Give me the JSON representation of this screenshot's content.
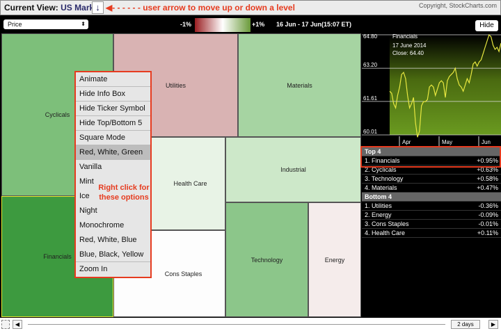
{
  "header": {
    "current_view_label": "Current View:",
    "current_view_value": "US Market",
    "level_arrow": "↓",
    "annotation": "user arrow to move up or down a level",
    "copyright": "Copyright, StockCharts.com"
  },
  "controls": {
    "measure_select": "Price",
    "legend_min": "-1%",
    "legend_max": "+1%",
    "date_range": "16 Jun - 17 Jun(15:07 ET)",
    "hide_button": "Hide"
  },
  "colors": {
    "accent_annotation": "#e63b1f",
    "gain": "#3d9a3f",
    "loss": "#9a1f22"
  },
  "treemap": [
    {
      "name": "Cyclicals",
      "change": 0.63
    },
    {
      "name": "Financials",
      "change": 0.95
    },
    {
      "name": "Utilities",
      "change": -0.36
    },
    {
      "name": "Materials",
      "change": 0.47
    },
    {
      "name": "Health Care",
      "change": 0.11
    },
    {
      "name": "Industrial",
      "change": 0.3
    },
    {
      "name": "Cons Staples",
      "change": -0.01
    },
    {
      "name": "Technology",
      "change": 0.58
    },
    {
      "name": "Energy",
      "change": -0.09
    }
  ],
  "context_menu": {
    "items": [
      "Animate",
      "Hide Info Box",
      "Hide Ticker Symbol",
      "Hide Top/Bottom 5",
      "Square Mode",
      "Red, White, Green",
      "Vanilla",
      "Mint",
      "Ice",
      "Night",
      "Monochrome",
      "Red, White, Blue",
      "Blue, Black, Yellow",
      "Zoom In"
    ],
    "hint": "Right click for these options"
  },
  "info_chart": {
    "title": "Financials",
    "date": "17  June 2014",
    "close": "Close: 64.40",
    "y_ticks": [
      "64.80",
      "63.20",
      "61.61",
      "60.01"
    ],
    "x_ticks": [
      "Apr",
      "May",
      "Jun"
    ],
    "values": [
      62.1,
      62.0,
      61.5,
      61.3,
      61.9,
      62.3,
      62.9,
      63.0,
      62.7,
      61.9,
      61.3,
      61.5,
      61.8,
      60.6,
      59.9,
      60.2,
      61.4,
      61.6,
      61.6,
      61.7,
      62.3,
      62.4,
      62.3,
      61.9,
      62.2,
      62.5,
      62.6,
      62.5,
      61.8,
      62.6,
      62.8,
      62.9,
      63.0,
      63.2,
      62.7,
      62.4,
      62.3,
      62.1,
      62.4,
      62.7,
      62.5,
      62.9,
      63.4,
      63.5,
      63.3,
      63.5,
      63.6,
      63.9,
      64.2,
      64.5,
      64.8,
      64.7,
      64.3,
      64.1,
      64.2,
      64.0,
      64.4
    ]
  },
  "top4": {
    "title": "Top 4",
    "rows": [
      {
        "name": "1. Financials",
        "value": "+0.95%"
      },
      {
        "name": "2. Cyclicals",
        "value": "+0.63%"
      },
      {
        "name": "3. Technology",
        "value": "+0.58%"
      },
      {
        "name": "4. Materials",
        "value": "+0.47%"
      }
    ]
  },
  "bottom4": {
    "title": "Bottom 4",
    "rows": [
      {
        "name": "1. Utilities",
        "value": "-0.36%"
      },
      {
        "name": "2. Energy",
        "value": "-0.09%"
      },
      {
        "name": "3. Cons Staples",
        "value": "-0.01%"
      },
      {
        "name": "4. Health Care",
        "value": "+0.11%"
      }
    ]
  },
  "footer": {
    "period": "2 days",
    "left": "◀",
    "right": "▶"
  }
}
